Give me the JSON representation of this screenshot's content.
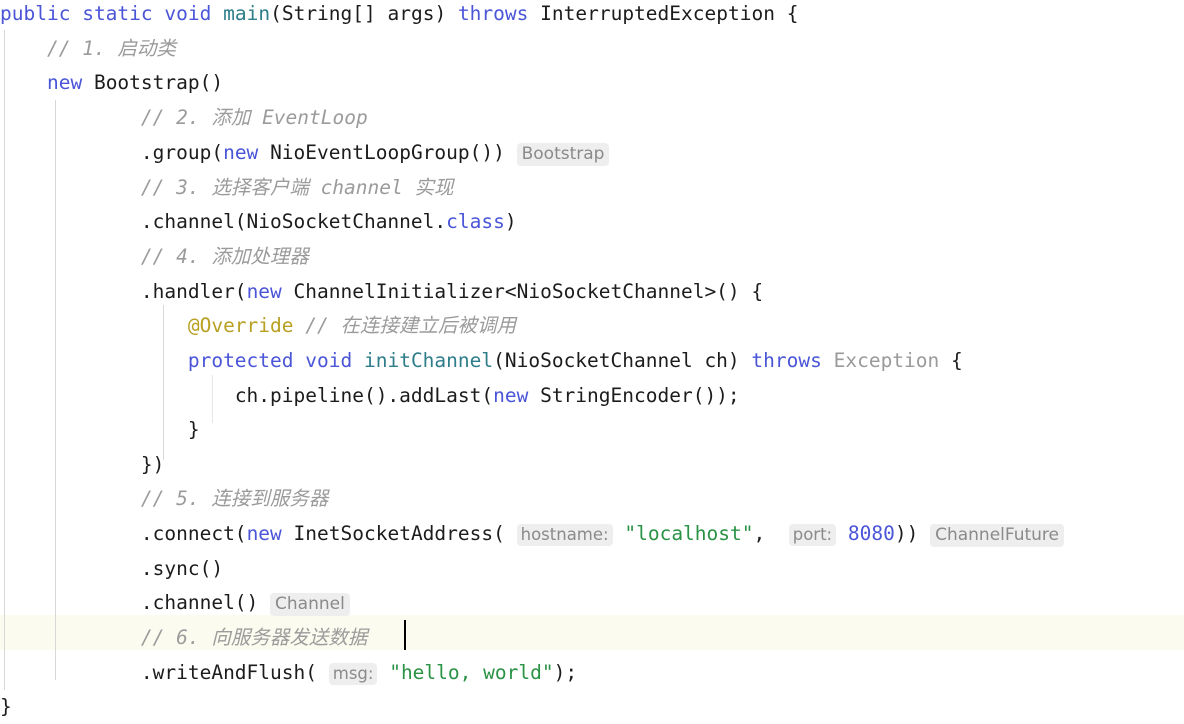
{
  "editor": {
    "language": "java",
    "background_color": "#ffffff",
    "current_line_color": "#fcfbef",
    "keyword_color": "#4a55d8",
    "string_color": "#2a9245",
    "comment_color": "#9b9b9b",
    "annotation_color": "#b8a023",
    "inlay_hint_bg": "#eeeeee",
    "inlay_hint_fg": "#8a8a8a",
    "caret_color": "#000000",
    "indent_guide_color": "#d8d8d8"
  },
  "code": {
    "line1": {
      "kw_public": "public",
      "kw_static": "static",
      "kw_void": "void",
      "name_main": "main",
      "params": "(String[] args) ",
      "kw_throws": "throws",
      "exception": "InterruptedException",
      "brace": "{"
    },
    "line2": {
      "comment": "// 1. 启动类"
    },
    "line3": {
      "kw_new": "new",
      "expr": "Bootstrap()"
    },
    "line4": {
      "comment": "// 2. 添加 EventLoop"
    },
    "line5": {
      "call_open": ".group(",
      "kw_new": "new",
      "call_rest": "NioEventLoopGroup()) ",
      "type_hint": "Bootstrap"
    },
    "line6": {
      "comment": "// 3. 选择客户端 channel 实现"
    },
    "line7": {
      "call": ".channel(NioSocketChannel.",
      "kw_class": "class",
      "close": ")"
    },
    "line8": {
      "comment": "// 4. 添加处理器"
    },
    "line9": {
      "call_open": ".handler(",
      "kw_new": "new",
      "call_rest": "ChannelInitializer<NioSocketChannel>() {"
    },
    "line10": {
      "annotation": "@Override",
      "comment": "// 在连接建立后被调用"
    },
    "line11": {
      "kw_protected": "protected",
      "kw_void": "void",
      "name": "initChannel",
      "params": "(NioSocketChannel ch) ",
      "kw_throws": "throws",
      "exception": "Exception",
      "brace": "{"
    },
    "line12": {
      "prefix": "ch.pipeline().addLast(",
      "kw_new": "new",
      "suffix": "StringEncoder());"
    },
    "line13": {
      "text": "}"
    },
    "line14": {
      "text": "})"
    },
    "line15": {
      "comment": "// 5. 连接到服务器"
    },
    "line16": {
      "call_open": ".connect(",
      "kw_new": "new",
      "ctor": "InetSocketAddress(",
      "hint_hostname": "hostname:",
      "str_host": "\"localhost\"",
      "comma": ", ",
      "hint_port": "port:",
      "num_port": "8080",
      "close": ")) ",
      "type_hint": "ChannelFuture"
    },
    "line17": {
      "text": ".sync()"
    },
    "line18": {
      "call": ".channel() ",
      "type_hint": "Channel"
    },
    "line19": {
      "comment": "// 6. 向服务器发送数据"
    },
    "line20": {
      "call_open": ".writeAndFlush(",
      "hint_msg": "msg:",
      "str_msg": "\"hello, world\"",
      "close": ");"
    },
    "line21": {
      "text": "}"
    }
  }
}
